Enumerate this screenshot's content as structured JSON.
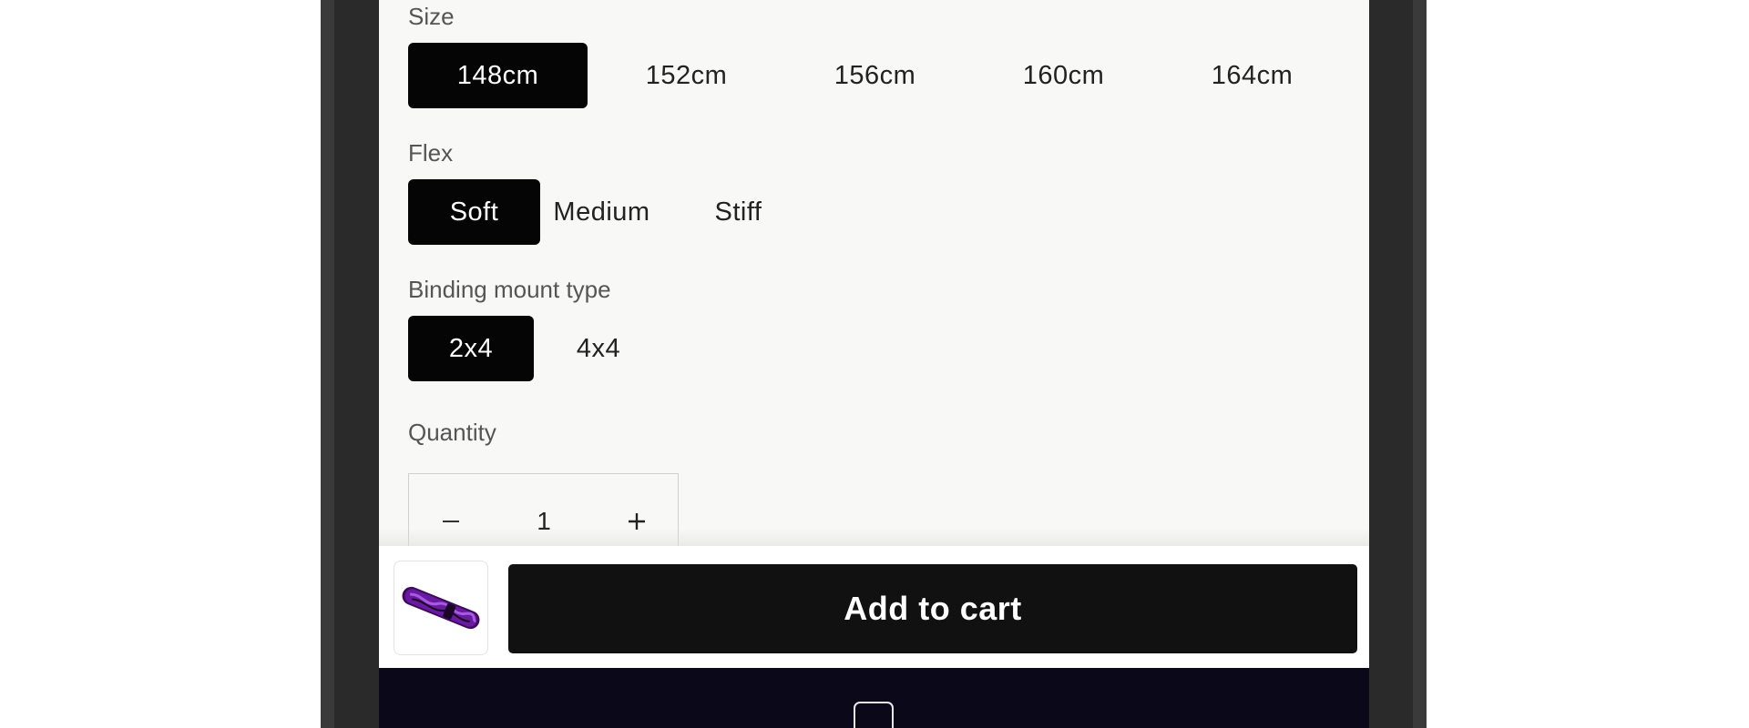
{
  "product_options": {
    "size": {
      "label": "Size",
      "options": [
        "148cm",
        "152cm",
        "156cm",
        "160cm",
        "164cm"
      ],
      "selected": "148cm"
    },
    "flex": {
      "label": "Flex",
      "options": [
        "Soft",
        "Medium",
        "Stiff"
      ],
      "selected": "Soft"
    },
    "binding_mount_type": {
      "label": "Binding mount type",
      "options": [
        "2x4",
        "4x4"
      ],
      "selected": "2x4"
    }
  },
  "quantity": {
    "label": "Quantity",
    "value": "1",
    "decrease_icon": "minus-icon",
    "increase_icon": "plus-icon"
  },
  "sticky_cart": {
    "button_label": "Add to cart",
    "thumbnail": "snowboard-thumbnail"
  },
  "colors": {
    "selected_pill": "#050505",
    "cart_button": "#111111",
    "bottom_bar": "#0b0919",
    "thumbnail_board": "#6a1aa0"
  }
}
